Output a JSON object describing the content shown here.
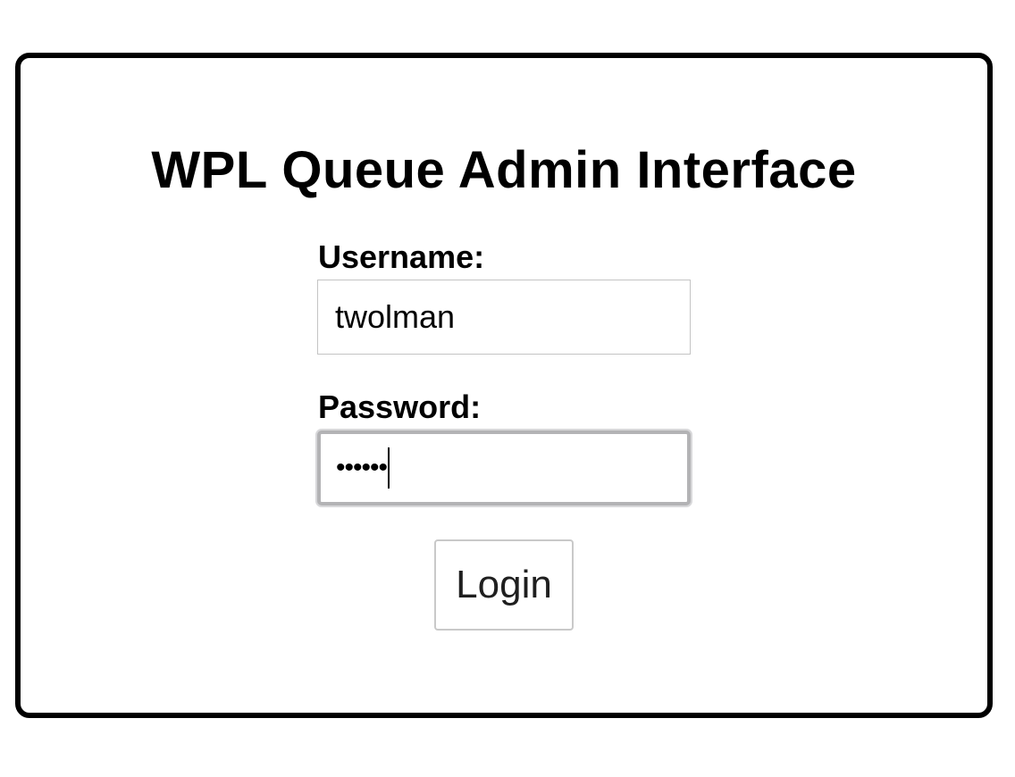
{
  "page": {
    "title": "WPL Queue Admin Interface"
  },
  "form": {
    "username_label": "Username:",
    "username_value": "twolman",
    "password_label": "Password:",
    "password_masked": "••••••",
    "login_label": "Login"
  }
}
